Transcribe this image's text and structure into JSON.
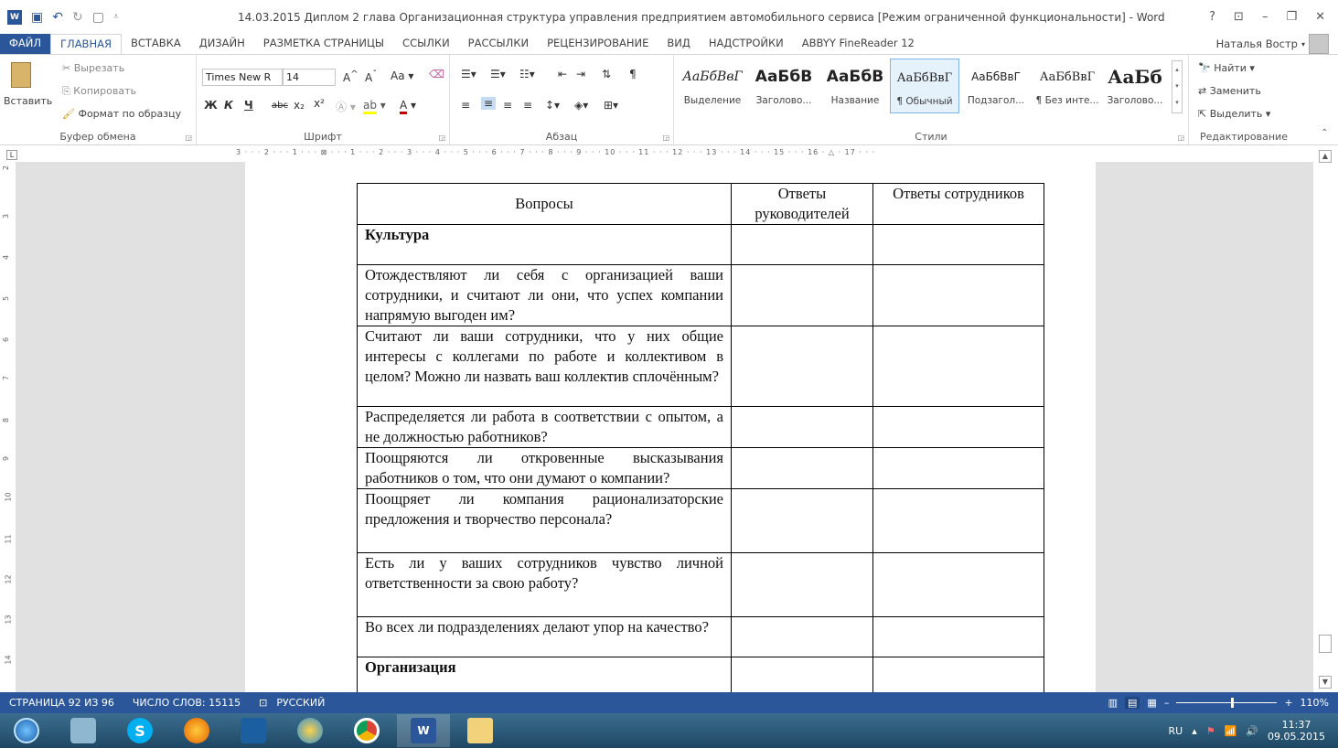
{
  "window": {
    "title": "14.03.2015 Диплом 2 глава Организационная структура управления предприятием автомобильного сервиса [Режим ограниченной функциональности] - Word",
    "controls": [
      "?",
      "⊡",
      "–",
      "❐",
      "✕"
    ]
  },
  "tabs": [
    "ФАЙЛ",
    "ГЛАВНАЯ",
    "ВСТАВКА",
    "ДИЗАЙН",
    "РАЗМЕТКА СТРАНИЦЫ",
    "ССЫЛКИ",
    "РАССЫЛКИ",
    "РЕЦЕНЗИРОВАНИЕ",
    "ВИД",
    "НАДСТРОЙКИ",
    "ABBYY FineReader 12"
  ],
  "user": "Наталья Востр",
  "clipboard": {
    "paste": "Вставить",
    "cut": "Вырезать",
    "copy": "Копировать",
    "format_painter": "Формат по образцу",
    "label": "Буфер обмена"
  },
  "font": {
    "name": "Times New R",
    "size": "14",
    "label": "Шрифт",
    "bold": "Ж",
    "italic": "К",
    "underline": "Ч",
    "strike": "abc"
  },
  "paragraph": {
    "label": "Абзац"
  },
  "styles": {
    "label": "Стили",
    "items": [
      {
        "sample": "АаБбВвГ",
        "name": "Выделение"
      },
      {
        "sample": "АаБбВ",
        "name": "Заголово..."
      },
      {
        "sample": "АаБбВ",
        "name": "Название"
      },
      {
        "sample": "АаБбВвГ",
        "name": "¶ Обычный"
      },
      {
        "sample": "АаБбВвГ",
        "name": "Подзагол..."
      },
      {
        "sample": "АаБбВвГ",
        "name": "¶ Без инте..."
      },
      {
        "sample": "АаБб",
        "name": "Заголово..."
      }
    ]
  },
  "editing": {
    "find": "Найти",
    "replace": "Заменить",
    "select": "Выделить",
    "label": "Редактирование"
  },
  "ruler": {
    "labels": "3 · · · 2 · · · 1 · · · ⊠ · · · 1 · · · 2 · · · 3 · · · 4 · · · 5 · · · 6 · · · 7 · · · 8 · · · 9 · · · 10 · · · 11 · · · 12 · · · 13 · · · 14 · · · 15 · · · 16 · △ · 17 · · ·"
  },
  "table": {
    "headers": [
      "Вопросы",
      "Ответы руководителей",
      "Ответы сотрудников"
    ],
    "rows": [
      {
        "q": "Культура",
        "section": true
      },
      {
        "q": "Отождествляют ли себя с организацией ваши сотрудники, и считают ли они, что успех компании напрямую выгоден им?"
      },
      {
        "q": "Считают ли ваши сотрудники, что у них общие интересы с коллегами по работе и коллективом в целом? Можно ли назвать ваш коллектив сплочённым?"
      },
      {
        "q": "Распределяется ли работа в соответствии с опытом, а не должностью работников?"
      },
      {
        "q": "Поощряются ли откровенные высказывания работников о том, что они думают о компании?"
      },
      {
        "q": "Поощряет ли компания рационализаторские предложения и творчество персонала?"
      },
      {
        "q": "Есть ли у ваших сотрудников чувство личной ответственности за свою работу?"
      },
      {
        "q": "Во всех ли подразделениях делают упор на качество?"
      },
      {
        "q": "Организация",
        "section": true
      }
    ]
  },
  "status": {
    "page": "СТРАНИЦА 92 ИЗ 96",
    "words": "ЧИСЛО СЛОВ: 15115",
    "lang": "РУССКИЙ",
    "zoom": "110%"
  },
  "taskbar": {
    "lang": "RU",
    "time": "11:37",
    "date": "09.05.2015"
  },
  "colors": {
    "accent": "#2b579a"
  }
}
